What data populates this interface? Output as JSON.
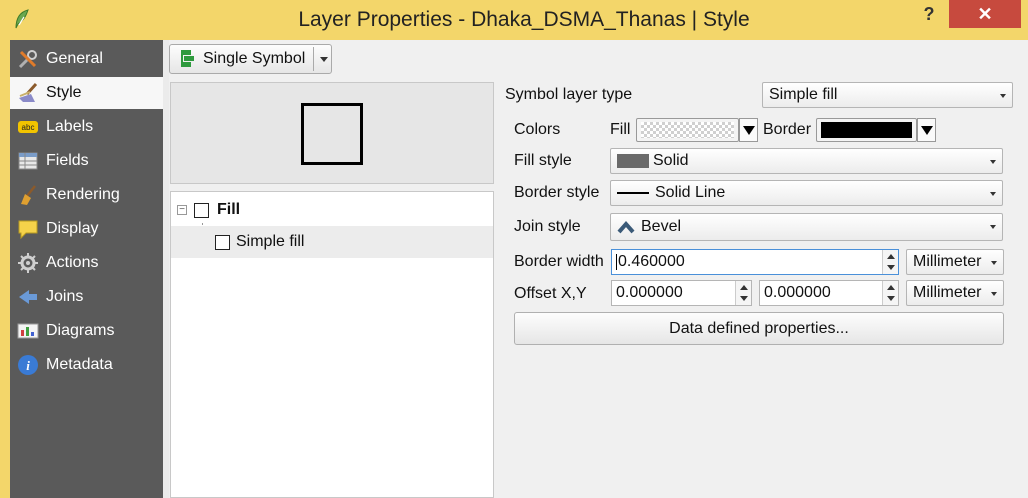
{
  "window": {
    "title": "Layer Properties - Dhaka_DSMA_Thanas | Style",
    "help_label": "?",
    "close_label": "✕"
  },
  "sidebar": {
    "items": [
      {
        "label": "General",
        "icon": "wrench-screwdriver-icon"
      },
      {
        "label": "Style",
        "icon": "paintbrush-icon",
        "active": true
      },
      {
        "label": "Labels",
        "icon": "abc-label-icon"
      },
      {
        "label": "Fields",
        "icon": "table-icon"
      },
      {
        "label": "Rendering",
        "icon": "broom-icon"
      },
      {
        "label": "Display",
        "icon": "speech-bubble-icon"
      },
      {
        "label": "Actions",
        "icon": "gear-icon"
      },
      {
        "label": "Joins",
        "icon": "join-arrow-icon"
      },
      {
        "label": "Diagrams",
        "icon": "diagram-icon"
      },
      {
        "label": "Metadata",
        "icon": "info-icon"
      }
    ]
  },
  "renderer": {
    "label": "Single Symbol"
  },
  "symbol_tree": {
    "root_label": "Fill",
    "child_label": "Simple fill"
  },
  "properties": {
    "symbol_layer_type_label": "Symbol layer type",
    "symbol_layer_type_value": "Simple fill",
    "colors_label": "Colors",
    "fill_label": "Fill",
    "border_label": "Border",
    "fill_style_label": "Fill style",
    "fill_style_value": "Solid",
    "border_style_label": "Border style",
    "border_style_value": "Solid Line",
    "join_style_label": "Join style",
    "join_style_value": "Bevel",
    "border_width_label": "Border width",
    "border_width_value": "0.460000",
    "border_width_unit": "Millimeter",
    "offset_label": "Offset X,Y",
    "offset_x": "0.000000",
    "offset_y": "0.000000",
    "offset_unit": "Millimeter",
    "data_defined_label": "Data defined properties..."
  },
  "colors": {
    "titlebar": "#f3d66a",
    "sidebar": "#5a5a5a",
    "border_color": "#000000",
    "close_button": "#c74a3e"
  }
}
